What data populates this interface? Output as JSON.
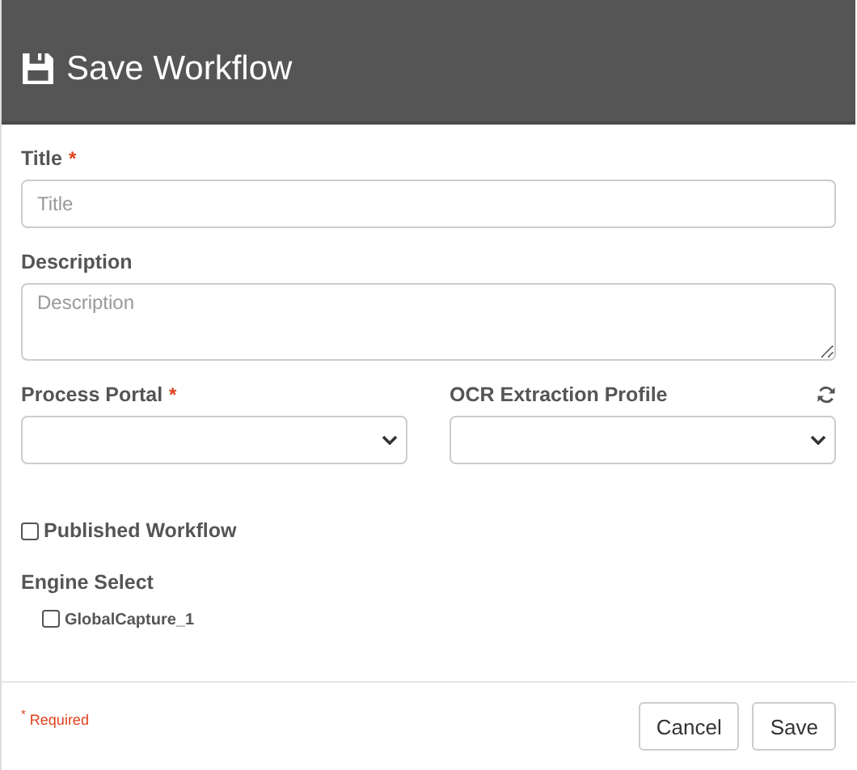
{
  "dialog": {
    "title": "Save Workflow"
  },
  "fields": [
    {
      "kind": "text",
      "label": "Title",
      "required_mark": "*",
      "placeholder": "Title"
    },
    {
      "kind": "textarea",
      "label": "Description",
      "placeholder": "Description"
    }
  ],
  "select_row": [
    {
      "label": "Process Portal",
      "required_mark": "*",
      "refresh_button": false
    },
    {
      "label": "OCR Extraction Profile",
      "refresh_button": true
    }
  ],
  "published": {
    "label": "Published Workflow",
    "checked": false
  },
  "engine_select": {
    "label": "Engine Select",
    "options": [
      {
        "label": "GlobalCapture_1",
        "checked": false
      }
    ]
  },
  "footer": {
    "required_note": "$^{*}$ Required",
    "buttons": [
      {
        "label": "Cancel"
      },
      {
        "label": "Save"
      }
    ]
  }
}
